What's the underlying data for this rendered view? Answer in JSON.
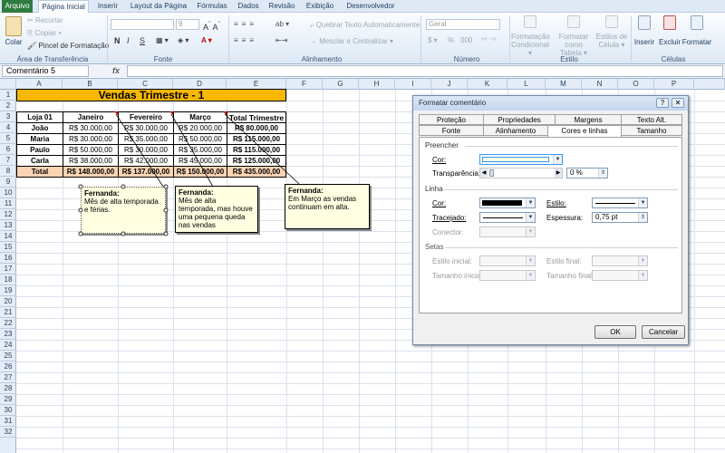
{
  "ribbon": {
    "tabs": [
      "Arquivo",
      "Página Inicial",
      "Inserir",
      "Layout da Página",
      "Fórmulas",
      "Dados",
      "Revisão",
      "Exibição",
      "Desenvolvedor"
    ],
    "clipboard": {
      "paste": "Colar",
      "cut": "Recortar",
      "copy": "Copiar ▾",
      "format_painter": "Pincel de Formatação",
      "group": "Área de Transferência"
    },
    "font": {
      "size": "9",
      "group": "Fonte",
      "bold": "N",
      "italic": "I",
      "underline": "S"
    },
    "alignment": {
      "wrap": "Quebrar Texto Automaticamente",
      "merge": "Mesclar e Centralizar ▾",
      "group": "Alinhamento"
    },
    "number": {
      "format": "Geral",
      "percent": "%",
      "thousands": "000",
      "group": "Número"
    },
    "styles": {
      "conditional": "Formatação Condicional ▾",
      "as_table": "Formatar como Tabela ▾",
      "cell_styles": "Estilos de Célula ▾",
      "group": "Estilo"
    },
    "cells": {
      "insert": "Inserir",
      "delete": "Excluir",
      "format": "Formatar",
      "group": "Células"
    }
  },
  "formula_bar": {
    "name_box": "Comentário 5",
    "fx": "fx",
    "formula": ""
  },
  "grid": {
    "columns": [
      "A",
      "B",
      "C",
      "D",
      "E",
      "F",
      "G",
      "H",
      "I",
      "J",
      "K",
      "L",
      "M",
      "N",
      "O",
      "P"
    ],
    "rows": [
      "1",
      "2",
      "3",
      "4",
      "5",
      "6",
      "7",
      "8",
      "9",
      "10",
      "11",
      "12",
      "13",
      "14",
      "15",
      "16",
      "17",
      "18",
      "19",
      "20",
      "21",
      "22",
      "23",
      "24",
      "25",
      "26",
      "27",
      "28",
      "29",
      "30",
      "31",
      "32"
    ]
  },
  "sheet": {
    "title": "Vendas Trimestre - 1",
    "headers": [
      "Loja 01",
      "Janeiro",
      "Fevereiro",
      "Março",
      "Total Trimestre"
    ],
    "rows": [
      [
        "João",
        "R$ 30.000,00",
        "R$ 30.000,00",
        "R$ 20.000,00",
        "R$ 80.000,00"
      ],
      [
        "Maria",
        "R$ 30.000,00",
        "R$ 35.000,00",
        "R$ 50.000,00",
        "R$ 115.000,00"
      ],
      [
        "Paulo",
        "R$ 50.000,00",
        "R$ 30.000,00",
        "R$ 35.000,00",
        "R$ 115.000,00"
      ],
      [
        "Carla",
        "R$ 38.000,00",
        "R$ 42.000,00",
        "R$ 45.000,00",
        "R$ 125.000,00"
      ],
      [
        "Total",
        "R$ 148.000,00",
        "R$ 137.000,00",
        "R$ 150.000,00",
        "R$ 435.000,00"
      ]
    ]
  },
  "comments": [
    {
      "author": "Fernanda:",
      "text": "Mês de alta temporada e férias."
    },
    {
      "author": "Fernanda:",
      "text": "Mês de alta temporada, mas houve uma pequena queda nas vendas"
    },
    {
      "author": "Fernanda:",
      "text": "Em Março as vendas continuam em alta."
    }
  ],
  "dialog": {
    "title": "Formatar comentário",
    "help": "?",
    "close": "✕",
    "tabs_back": [
      "Proteção",
      "Propriedades",
      "Margens",
      "Texto Alt."
    ],
    "tabs_front": [
      "Fonte",
      "Alinhamento",
      "Cores e linhas",
      "Tamanho"
    ],
    "fill": {
      "section": "Preencher",
      "color_label": "Cor:",
      "transparency_label": "Transparência:",
      "transparency_value": "0 %"
    },
    "line": {
      "section": "Linha",
      "color_label": "Cor:",
      "style_label": "Estilo:",
      "dashed_label": "Tracejado:",
      "weight_label": "Espessura:",
      "weight_value": "0,75 pt",
      "connector_label": "Conector:"
    },
    "arrows": {
      "section": "Setas",
      "begin_style": "Estilo inicial:",
      "end_style": "Estilo final:",
      "begin_size": "Tamanho inicial:",
      "end_size": "Tamanho final:"
    },
    "ok": "OK",
    "cancel": "Cancelar"
  }
}
